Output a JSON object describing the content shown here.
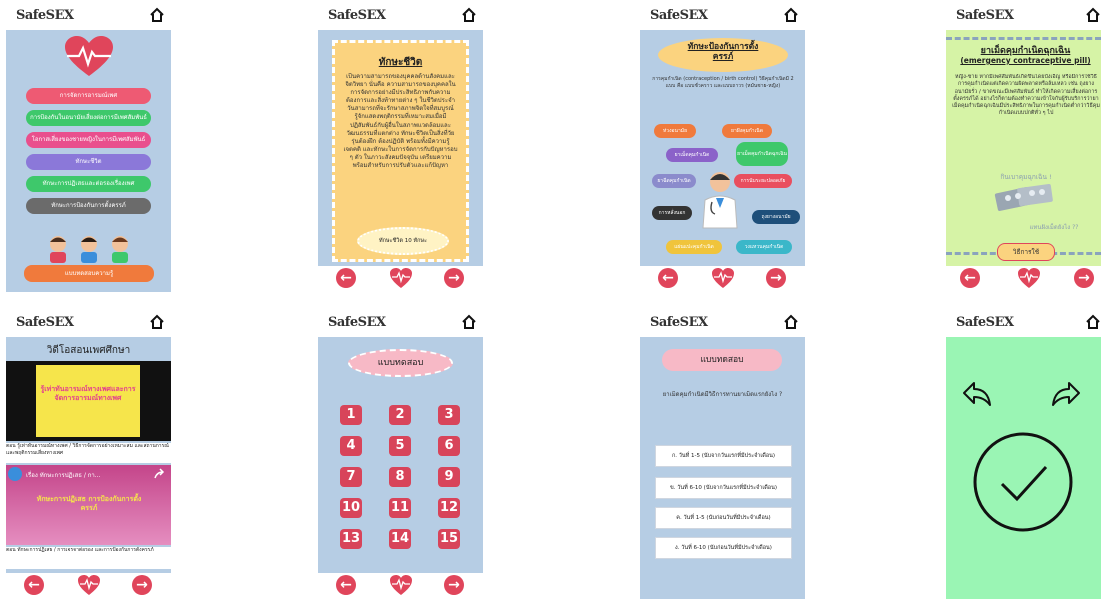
{
  "brand": "SafeSEX",
  "s1": {
    "menu": [
      {
        "label": "การจัดการอารมณ์เพศ",
        "color": "#ee5a73"
      },
      {
        "label": "การป้องกันในอนามัยเสี่ยงต่อการมีเพศสัมพันธ์",
        "color": "#3ec86b"
      },
      {
        "label": "โอกาสเสี่ยงของชายหญิงในการมีเพศสัมพันธ์",
        "color": "#e94f8d"
      },
      {
        "label": "ทักษะชีวิต",
        "color": "#8b78d9"
      },
      {
        "label": "ทักษะการปฏิเสธและต่อรองเรื่องเพศ",
        "color": "#3ec86b"
      },
      {
        "label": "ทักษะการป้องกันการตั้งครรภ์",
        "color": "#6b6b6b"
      }
    ],
    "quiz_label": "แบบทดสอบความรู้"
  },
  "s2": {
    "title": "ทักษะชีวิต",
    "body": "เป็นความสามารถของบุคคลด้านสังคมและจิตวิทยา นั่นคือ ความสามารถของบุคคลในการจัดการอย่างมีประสิทธิภาพกับความต้องการและสิ่งท้าทายต่าง ๆ ในชีวิตประจำวันสามารถที่จะรักษาสภาพจิตใจที่สมบูรณ์ รู้จักแสดงพฤติกรรมที่เหมาะสมเมื่อมีปฏิสัมพันธ์กับผู้อื่นในสภาพแวดล้อมและวัฒนธรรมที่แตกต่าง ทักษะชีวิตเป็นสิ่งที่วัยรุ่นต้องฝึก ต้องปฏิบัติ พร้อมทั้งมีความรู้ เจตคติ และทักษะในการจัดการกับปัญหารอบ ๆ ตัว ในภาวะสังคมปัจจุบัน เตรียมความพร้อมสำหรับการปรับตัวและแก้ปัญหา",
    "badge": "ทักษะชีวิต 10 ทักษะ"
  },
  "s3": {
    "title": "ทักษะป้องกันการตั้งครรภ์",
    "body": "การคุมกำเนิด (contraception / birth control) วิธีคุมกำเนิดมี 2 แบบ คือ แบบชั่วคราว และแบบถาวร (หมันชาย-หญิง)",
    "methods": [
      {
        "label": "ห่วงอนามัย",
        "color": "#f07a3c"
      },
      {
        "label": "ยาฝังคุมกำเนิด",
        "color": "#f07a3c"
      },
      {
        "label": "ยาเม็ดคุมกำเนิด",
        "color": "#8b62c9"
      },
      {
        "label": "ยาเม็ดคุมกำเนิดฉุกเฉิน",
        "color": "#3ec86b"
      },
      {
        "label": "ยาฉีดคุมกำเนิด",
        "color": "#8b8bcc"
      },
      {
        "label": "การนับระยะปลอดภัย",
        "color": "#e94f5f"
      },
      {
        "label": "การหลั่งนอก",
        "color": "#333333"
      },
      {
        "label": "ถุงยางอนามัย",
        "color": "#1e4f7a"
      },
      {
        "label": "แผ่นแปะคุมกำเนิด",
        "color": "#f0c43c"
      },
      {
        "label": "วงแหวนคุมกำเนิด",
        "color": "#3bb7c9"
      }
    ]
  },
  "s4": {
    "title": "ยาเม็ดคุมกำเนิดฉุกเฉิน",
    "subtitle": "(emergency contraceptive pill)",
    "body": "หญิง-ชาย หากมีเพศสัมพันธ์เกิดขึ้นโดยบังเอิญ หรือมีการใช้วิธีการคุมกำเนิดแต่เกิดความผิดพลาดหรือล้มเหลว เช่น ถุงยางอนามัยรั่ว / ขาดขณะมีเพศสัมพันธ์ ทำให้เกิดความเสี่ยงต่อการตั้งครรภ์ได้ อย่างไรก็ตามต้องทำความเข้าใจกับผู้รับบริการว่ายาเม็ดคุมกำเนิดฉุกเฉินมีประสิทธิภาพในการคุมกำเนิดต่ำกว่าวิธีคุมกำเนิดแบบปกติทั่ว ๆ ไป",
    "caption1": "กินเบาคุมฉุกเฉิน !",
    "caption2": "แทนฝังเม็ดยังไง ??",
    "button": "วิธีการใช้"
  },
  "s5": {
    "title": "วิดีโอสอนเพศศึกษา",
    "video1_title": "รู้เท่าทันอารมณ์ทางเพศและการจัดการอารมณ์ทางเพศ",
    "video1_caption": "ตอน รู้เท่าทันอารมณ์ทางเพศ / วิธีการจัดการอย่างเหมาะสม และสถานการณ์และพฤติกรรมเสี่ยงทางเพศ",
    "video2_header": "เรื่อง ทักษะการปฏิเสธ / กา...",
    "video2_title": "ทักษะการปฏิเสธ การป้องกันการตั้งครรภ์",
    "video2_caption": "ตอน ทักษะการปฏิเสธ / การเจรจาต่อรอง และการป้องกันการตั้งครรภ์"
  },
  "s6": {
    "title": "แบบทดสอบ",
    "numbers": [
      "1",
      "2",
      "3",
      "4",
      "5",
      "6",
      "7",
      "8",
      "9",
      "10",
      "11",
      "12",
      "13",
      "14",
      "15"
    ]
  },
  "s7": {
    "title": "แบบทดสอบ",
    "question": "ยาเม็ดคุมกำเนิดมีวิธีการทานยาเม็ดแรกยังไง ?",
    "answers": [
      "ก. วันที่ 1-5 (นับจากวันแรกที่มีประจำเดือน)",
      "ข. วันที่ 6-10 (นับจากวันแรกที่มีประจำเดือน)",
      "ค. วันที่ 1-5 (นับก่อนวันที่มีประจำเดือน)",
      "ง. วันที่ 6-10 (นับก่อนวันที่มีประจำเดือน)"
    ]
  },
  "colors": {
    "panel": "#b6cde4",
    "accent": "#e0455b",
    "note_yellow": "#fbd37f",
    "success_green": "#9af5b4"
  },
  "icons": {
    "home": "home-icon",
    "prev": "arrow-left-icon",
    "next": "arrow-right-icon",
    "heart": "heart-pulse-icon"
  }
}
